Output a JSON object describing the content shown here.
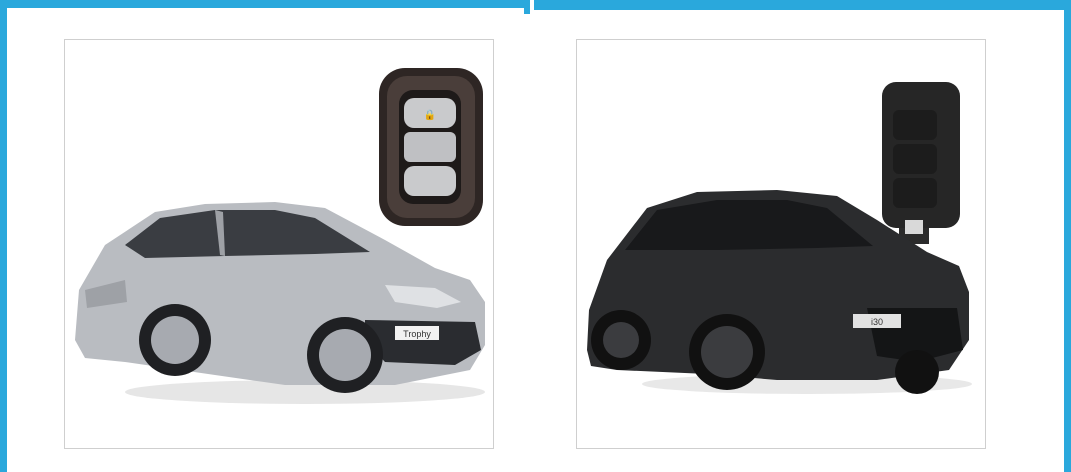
{
  "frame": {
    "accent_color": "#2aa8dc"
  },
  "panels": [
    {
      "name": "older-model",
      "car": {
        "body_color": "#b9bcc1",
        "badge_text": "Trophy"
      },
      "key": {
        "type": "smart-key-fob",
        "shell_color": "#2e2624",
        "button_color": "#c9cacc"
      }
    },
    {
      "name": "newer-model",
      "car": {
        "body_color": "#2b2c2e",
        "badge_text": "i30"
      },
      "key": {
        "type": "flip-key",
        "shell_color": "#262626",
        "button_count": 3
      }
    }
  ]
}
